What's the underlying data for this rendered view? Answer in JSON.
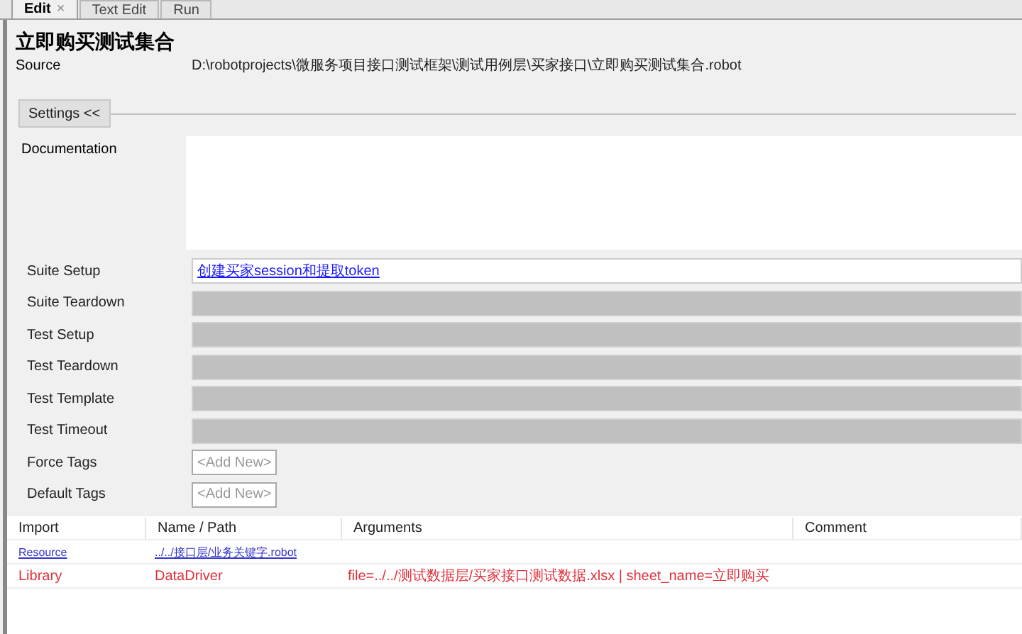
{
  "tabs": [
    {
      "label": "Edit",
      "selected": true,
      "close": "×"
    },
    {
      "label": "Text Edit",
      "selected": false
    },
    {
      "label": "Run",
      "selected": false
    }
  ],
  "suite": {
    "title": "立即购买测试集合",
    "source_label": "Source",
    "source_path": "D:\\robotprojects\\微服务项目接口测试框架\\测试用例层\\买家接口\\立即购买测试集合.robot"
  },
  "settings_button": "Settings <<",
  "documentation": {
    "label": "Documentation"
  },
  "settings": [
    {
      "label": "Suite Setup",
      "kind": "link",
      "value": "创建买家session和提取token"
    },
    {
      "label": "Suite Teardown",
      "kind": "empty"
    },
    {
      "label": "Test Setup",
      "kind": "empty"
    },
    {
      "label": "Test Teardown",
      "kind": "empty"
    },
    {
      "label": "Test Template",
      "kind": "empty"
    },
    {
      "label": "Test Timeout",
      "kind": "empty"
    },
    {
      "label": "Force Tags",
      "kind": "tags",
      "value": "<Add New>"
    },
    {
      "label": "Default Tags",
      "kind": "tags",
      "value": "<Add New>"
    }
  ],
  "imports": {
    "columns": [
      "Import",
      "Name / Path",
      "Arguments",
      "Comment"
    ],
    "rows": [
      {
        "kind": "resource",
        "import": "Resource",
        "path": "../../接口层/业务关键字.robot"
      },
      {
        "kind": "library",
        "import": "Library",
        "path": "DataDriver",
        "arguments": "file=../../测试数据层/买家接口测试数据.xlsx | sheet_name=立即购买"
      }
    ]
  }
}
